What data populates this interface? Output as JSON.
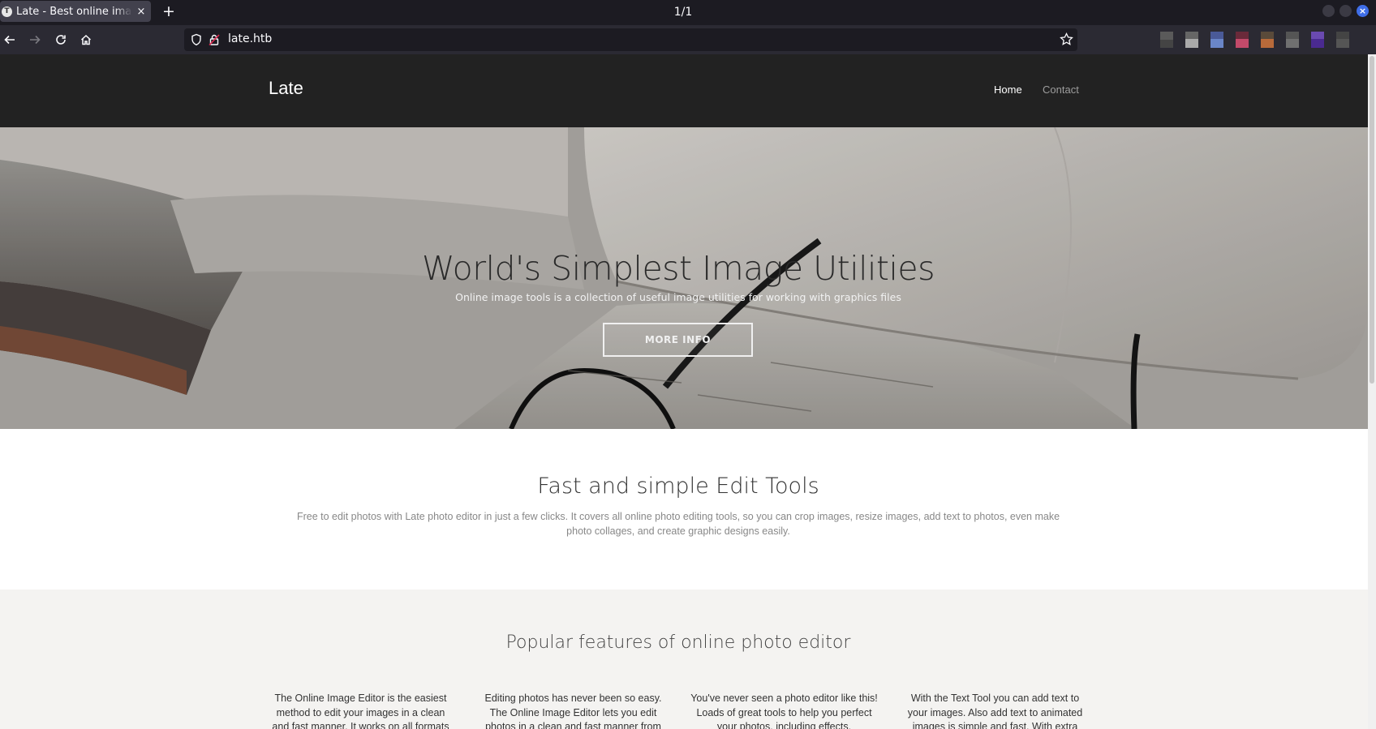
{
  "browser": {
    "tab_title": "Late - Best online image tools",
    "favicon_letter": "T",
    "new_tab": "+",
    "close_tab": "×",
    "page_counter": "1/1",
    "url": "late.htb",
    "window_close": "×"
  },
  "site": {
    "brand": "Late",
    "nav": {
      "home": "Home",
      "contact": "Contact"
    }
  },
  "hero": {
    "title": "World's Simplest Image Utilities",
    "subtitle": "Online image tools is a collection of useful image utilities for working with graphics files",
    "button": "MORE INFO"
  },
  "edit_tools": {
    "title": "Fast and simple Edit Tools",
    "text": "Free to edit photos with Late photo editor in just a few clicks. It covers all online photo editing tools, so you can crop images, resize images, add text to photos, even make photo collages, and create graphic designs easily."
  },
  "features": {
    "title": "Popular features of online photo editor",
    "items": [
      "The Online Image Editor is the easiest method to edit your images in a clean and fast manner. It works on all formats like:",
      "Editing photos has never been so easy. The Online Image Editor lets you edit photos in a clean and fast manner from",
      "You've never seen a photo editor like this! Loads of great tools to help you perfect your photos, including effects, background",
      "With the Text Tool you can add text to your images. Also add text to animated images is simple and fast. With extra"
    ]
  },
  "extension_colors": [
    "#5a5a5a",
    "#9a9a9a",
    "#5a6ea8",
    "#c24a6a",
    "#b86a3a",
    "#707070",
    "#6a4ab0",
    "#555555"
  ]
}
